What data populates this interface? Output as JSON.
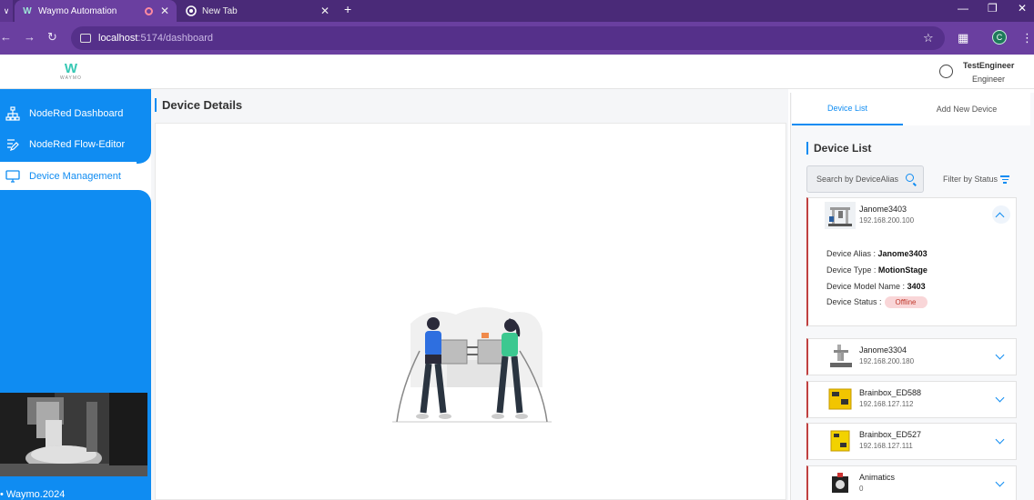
{
  "browser": {
    "tabs": [
      {
        "title": "Waymo Automation"
      },
      {
        "title": "New Tab"
      }
    ],
    "url_host": "localhost",
    "url_path": ":5174/dashboard",
    "profile_initial": "C"
  },
  "header": {
    "brand": "WAYMO",
    "user_name": "TestEngineer",
    "user_role": "Engineer"
  },
  "sidebar": {
    "items": [
      {
        "label": "NodeRed Dashboard",
        "icon": "sitemap-icon"
      },
      {
        "label": "NodeRed Flow-Editor",
        "icon": "flow-editor-icon"
      },
      {
        "label": "Device Management",
        "icon": "monitor-icon"
      }
    ],
    "footer": "Waymo.2024"
  },
  "main": {
    "title": "Device Details"
  },
  "right_panel": {
    "tabs": [
      "Device List",
      "Add New Device"
    ],
    "list_title": "Device List",
    "search_placeholder": "Search by DeviceAlias",
    "filter_label": "Filter by Status",
    "devices": [
      {
        "name": "Janome3403",
        "ip": "192.168.200.100",
        "expanded": true
      },
      {
        "name": "Janome3304",
        "ip": "192.168.200.180"
      },
      {
        "name": "Brainbox_ED588",
        "ip": "192.168.127.112"
      },
      {
        "name": "Brainbox_ED527",
        "ip": "192.168.127.111"
      },
      {
        "name": "Animatics",
        "ip": "0"
      }
    ],
    "selected_details": {
      "alias_label": "Device Alias :",
      "alias_value": "Janome3403",
      "type_label": "Device Type :",
      "type_value": "MotionStage",
      "model_label": "Device Model Name :",
      "model_value": "3403",
      "status_label": "Device Status :",
      "status_value": "Offline"
    }
  },
  "colors": {
    "accent": "#0f8cf2",
    "browser_frame": "#6a3fa0",
    "status_offline_bg": "#f9d6d8",
    "status_offline_text": "#c0392b"
  }
}
